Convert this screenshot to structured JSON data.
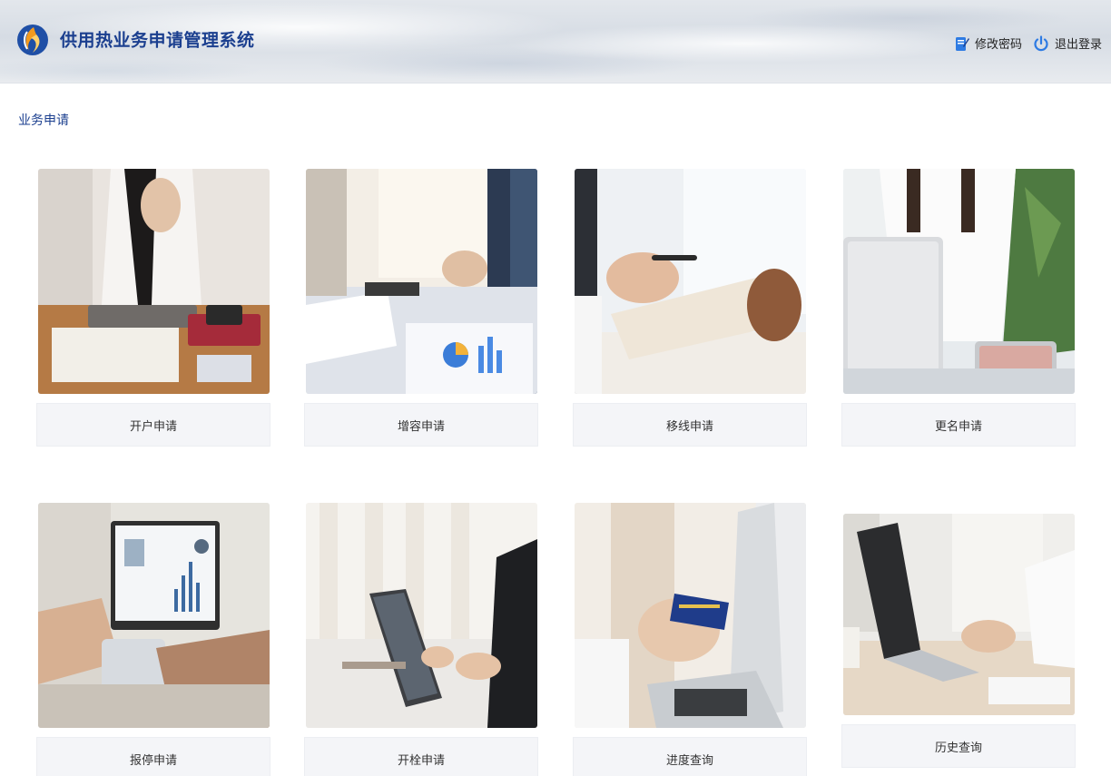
{
  "header": {
    "title": "供用热业务申请管理系统",
    "logo_icon": "flame-logo-icon",
    "actions": {
      "change_password": "修改密码",
      "logout": "退出登录"
    }
  },
  "breadcrumb": {
    "title": "业务申请"
  },
  "cards": [
    {
      "label": "开户申请",
      "icon": "tablet-desk-photo"
    },
    {
      "label": "增容申请",
      "icon": "meeting-charts-photo"
    },
    {
      "label": "移线申请",
      "icon": "handshake-document-photo"
    },
    {
      "label": "更名申请",
      "icon": "laptop-woman-photo"
    },
    {
      "label": "报停申请",
      "icon": "calculator-charts-photo"
    },
    {
      "label": "开栓申请",
      "icon": "tablet-stand-photo"
    },
    {
      "label": "进度查询",
      "icon": "credit-card-laptop-photo"
    },
    {
      "label": "历史查询",
      "icon": "laptop-typing-photo"
    }
  ],
  "colors": {
    "brand_blue": "#1b3f8f",
    "card_label_bg": "#f4f5f8"
  }
}
